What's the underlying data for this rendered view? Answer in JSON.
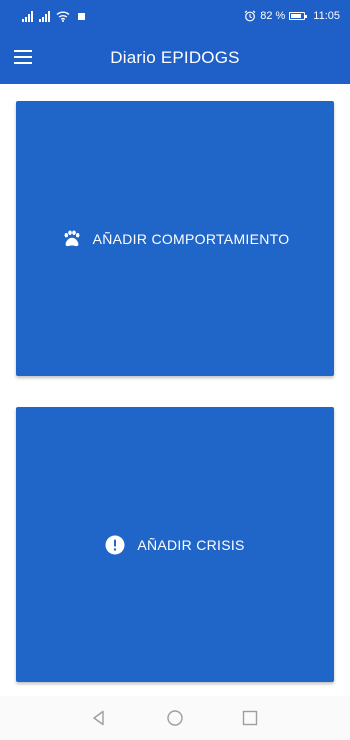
{
  "status_bar": {
    "battery_percent": "82 %",
    "battery_level": 0.82,
    "time": "11:05",
    "icons": [
      "signal-icon",
      "signal-icon",
      "wifi-icon",
      "stop-icon",
      "alarm-icon",
      "battery-icon"
    ]
  },
  "app_bar": {
    "title": "Diario EPIDOGS",
    "menu_icon": "menu-icon"
  },
  "actions": [
    {
      "label": "AÑADIR COMPORTAMIENTO",
      "icon": "paw-icon"
    },
    {
      "label": "AÑADIR CRISIS",
      "icon": "alert-icon"
    }
  ],
  "nav_bar": {
    "icons": [
      "back-icon",
      "home-icon",
      "recents-icon"
    ]
  },
  "colors": {
    "primary": "#1e5fc8",
    "card": "#2066c9",
    "nav_background": "#fafafa",
    "nav_icon": "#9e9e9e"
  }
}
